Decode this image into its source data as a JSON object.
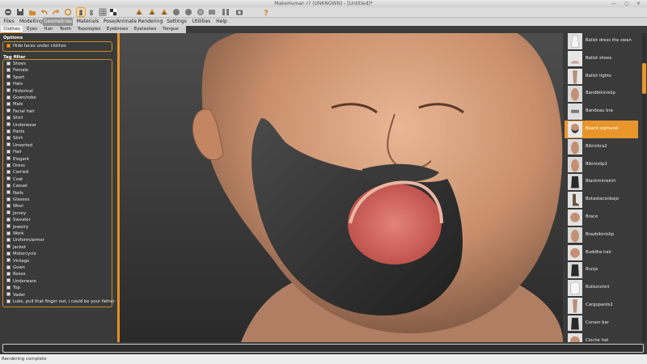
{
  "window": {
    "title": "MakeHuman r? (UNKNOWN) - [Untitled]*",
    "controls": "— ◻ ✕"
  },
  "toolbar": {
    "icons": [
      "exit-icon",
      "save-icon",
      "load-icon",
      "undo-icon",
      "redo-icon",
      "reset-icon",
      "wireframe-icon",
      "smooth-icon",
      "grid-icon",
      "checker-icon",
      "front-view-icon",
      "back-view-icon",
      "side-view-icon",
      "top-view-icon",
      "bottom-view-icon",
      "left-view-icon",
      "right-view-icon",
      "reset-camera-icon",
      "screenshot-icon",
      "help-icon"
    ],
    "accent": "#e89c2c"
  },
  "menu_tabs": [
    {
      "label": "Files"
    },
    {
      "label": "Modelling"
    },
    {
      "label": "Geometries",
      "active": true
    },
    {
      "label": "Materials"
    },
    {
      "label": "Pose/Animate"
    },
    {
      "label": "Rendering"
    },
    {
      "label": "Settings"
    },
    {
      "label": "Utilities"
    },
    {
      "label": "Help"
    }
  ],
  "sub_tabs": [
    {
      "label": "Clothes",
      "active": true
    },
    {
      "label": "Eyes"
    },
    {
      "label": "Hair"
    },
    {
      "label": "Teeth"
    },
    {
      "label": "Topologies"
    },
    {
      "label": "Eyebrows"
    },
    {
      "label": "Eyelashes"
    },
    {
      "label": "Tongue"
    }
  ],
  "options": {
    "title": "Options",
    "hide_faces": {
      "label": "Hide faces under clothes",
      "checked": true
    }
  },
  "tag_filter": {
    "title": "Tag filter",
    "tags": [
      "Shoes",
      "Female",
      "Sport",
      "Hats",
      "Historical",
      "Gown/robe",
      "Male",
      "Facial hair",
      "Shirt",
      "Underwear",
      "Pants",
      "Skirt",
      "Unsorted",
      "Hair",
      "Elegant",
      "Dress",
      "Carried",
      "Coat",
      "Casual",
      "Nails",
      "Glasses",
      "Wool",
      "Jersey",
      "Sweater",
      "Jewelry",
      "Work",
      "Uniform/armor",
      "Jacket",
      "Motorcycle",
      "Vintage",
      "Gown",
      "Roses",
      "Underware",
      "Top",
      "Vader",
      "Luke, pull that finger out, i could be your father"
    ]
  },
  "clothes_list": [
    {
      "label": "Ballet dress the swan",
      "thumb": "dress"
    },
    {
      "label": "Ballet shoes",
      "thumb": "shoes"
    },
    {
      "label": "Ballet tights",
      "thumb": "legs"
    },
    {
      "label": "Bandbikinislip",
      "thumb": "body"
    },
    {
      "label": "Bandeau bra",
      "thumb": "bra"
    },
    {
      "label": "Beard sigmund",
      "thumb": "beard",
      "selected": true
    },
    {
      "label": "Bikinibra2",
      "thumb": "body"
    },
    {
      "label": "Bikinislip2",
      "thumb": "body"
    },
    {
      "label": "Blackminiskirt",
      "thumb": "dark"
    },
    {
      "label": "Botastaconbajo",
      "thumb": "boots"
    },
    {
      "label": "Brace",
      "thumb": "head"
    },
    {
      "label": "Brazbikinislip",
      "thumb": "body"
    },
    {
      "label": "Buddha hair",
      "thumb": "head"
    },
    {
      "label": "Bunja",
      "thumb": "dark"
    },
    {
      "label": "Buttonshirt",
      "thumb": "shirt"
    },
    {
      "label": "Cargopants2",
      "thumb": "legs"
    },
    {
      "label": "Censor bar",
      "thumb": "dark"
    },
    {
      "label": "Cloche hat",
      "thumb": "head"
    }
  ],
  "status": {
    "text": "Rendering complete",
    "command_value": ""
  }
}
